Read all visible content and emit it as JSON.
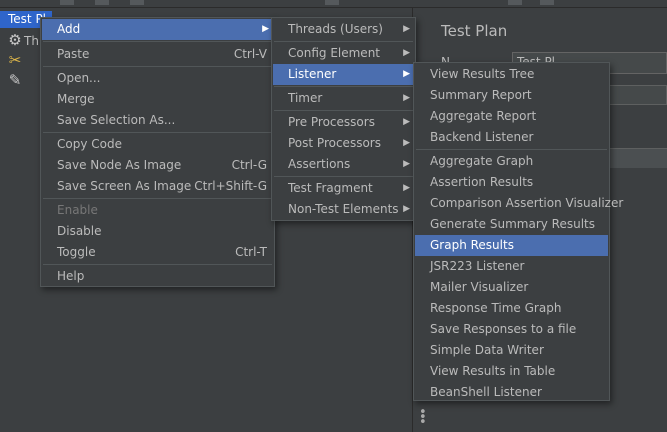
{
  "tree": {
    "root_label": "Test Pl",
    "nodes": [
      {
        "icon": "gear-icon",
        "glyph": "⚙",
        "label": "Th"
      },
      {
        "icon": "tools-icon",
        "glyph": "✂",
        "label": ""
      },
      {
        "icon": "pipette-icon",
        "glyph": "✎",
        "label": ""
      }
    ]
  },
  "right_panel": {
    "title": "Test Plan",
    "name_label": "N",
    "name_value": "Test Pl"
  },
  "context_menu": {
    "items": [
      {
        "label": "Add",
        "shortcut": "",
        "submenu": true,
        "active": true,
        "disabled": false
      },
      {
        "label": "Paste",
        "shortcut": "Ctrl-V",
        "submenu": false,
        "active": false,
        "disabled": false
      },
      {
        "label": "Open...",
        "shortcut": "",
        "submenu": false,
        "active": false,
        "disabled": false
      },
      {
        "label": "Merge",
        "shortcut": "",
        "submenu": false,
        "active": false,
        "disabled": false
      },
      {
        "label": "Save Selection As...",
        "shortcut": "",
        "submenu": false,
        "active": false,
        "disabled": false
      },
      {
        "label": "Copy Code",
        "shortcut": "",
        "submenu": false,
        "active": false,
        "disabled": false
      },
      {
        "label": "Save Node As Image",
        "shortcut": "Ctrl-G",
        "submenu": false,
        "active": false,
        "disabled": false
      },
      {
        "label": "Save Screen As Image",
        "shortcut": "Ctrl+Shift-G",
        "submenu": false,
        "active": false,
        "disabled": false
      },
      {
        "label": "Enable",
        "shortcut": "",
        "submenu": false,
        "active": false,
        "disabled": true
      },
      {
        "label": "Disable",
        "shortcut": "",
        "submenu": false,
        "active": false,
        "disabled": false
      },
      {
        "label": "Toggle",
        "shortcut": "Ctrl-T",
        "submenu": false,
        "active": false,
        "disabled": false
      },
      {
        "label": "Help",
        "shortcut": "",
        "submenu": false,
        "active": false,
        "disabled": false
      }
    ]
  },
  "add_submenu": {
    "items": [
      {
        "label": "Threads (Users)",
        "active": false
      },
      {
        "label": "Config Element",
        "active": false
      },
      {
        "label": "Listener",
        "active": true
      },
      {
        "label": "Timer",
        "active": false
      },
      {
        "label": "Pre Processors",
        "active": false
      },
      {
        "label": "Post Processors",
        "active": false
      },
      {
        "label": "Assertions",
        "active": false
      },
      {
        "label": "Test Fragment",
        "active": false
      },
      {
        "label": "Non-Test Elements",
        "active": false
      }
    ]
  },
  "listener_submenu": {
    "items": [
      {
        "label": "View Results Tree",
        "active": false
      },
      {
        "label": "Summary Report",
        "active": false
      },
      {
        "label": "Aggregate Report",
        "active": false
      },
      {
        "label": "Backend Listener",
        "active": false
      },
      {
        "label": "Aggregate Graph",
        "active": false
      },
      {
        "label": "Assertion Results",
        "active": false
      },
      {
        "label": "Comparison Assertion Visualizer",
        "active": false
      },
      {
        "label": "Generate Summary Results",
        "active": false
      },
      {
        "label": "Graph Results",
        "active": true
      },
      {
        "label": "JSR223 Listener",
        "active": false
      },
      {
        "label": "Mailer Visualizer",
        "active": false
      },
      {
        "label": "Response Time Graph",
        "active": false
      },
      {
        "label": "Save Responses to a file",
        "active": false
      },
      {
        "label": "Simple Data Writer",
        "active": false
      },
      {
        "label": "View Results in Table",
        "active": false
      },
      {
        "label": "BeanShell Listener",
        "active": false
      }
    ]
  }
}
